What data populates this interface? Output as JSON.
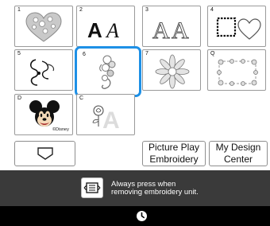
{
  "tiles": [
    {
      "label": "1",
      "icon": "heart-flower-icon"
    },
    {
      "label": "2",
      "icon": "script-letters-icon",
      "glyph": "A𝒜"
    },
    {
      "label": "3",
      "icon": "outline-letters-icon",
      "glyph": "AA"
    },
    {
      "label": "4",
      "icon": "stamp-heart-icon"
    },
    {
      "label": "5",
      "icon": "swirl-ornament-icon"
    },
    {
      "label": "6",
      "icon": "floral-vine-icon",
      "selected": true
    },
    {
      "label": "7",
      "icon": "mandala-icon"
    },
    {
      "label": "Q",
      "icon": "floral-frame-icon"
    },
    {
      "label": "D",
      "icon": "mickey-icon",
      "brand": "©Disney"
    },
    {
      "label": "C",
      "icon": "rose-letter-icon",
      "glyph": "A"
    }
  ],
  "buttons": {
    "pocket_icon": "pocket-icon",
    "picture_play": "Picture Play\nEmbroidery",
    "picture_play_lines": [
      "Picture Play",
      "Embroidery"
    ],
    "my_design_lines": [
      "My Design",
      "Center"
    ]
  },
  "notice": {
    "icon": "embroidery-unit-release-icon",
    "lines": [
      "Always press when",
      "removing embroidery unit."
    ]
  },
  "footer": {
    "icon": "clock-icon"
  },
  "colors": {
    "selection": "#1e90e6",
    "bar": "#3a3a3a",
    "footer": "#000000"
  }
}
